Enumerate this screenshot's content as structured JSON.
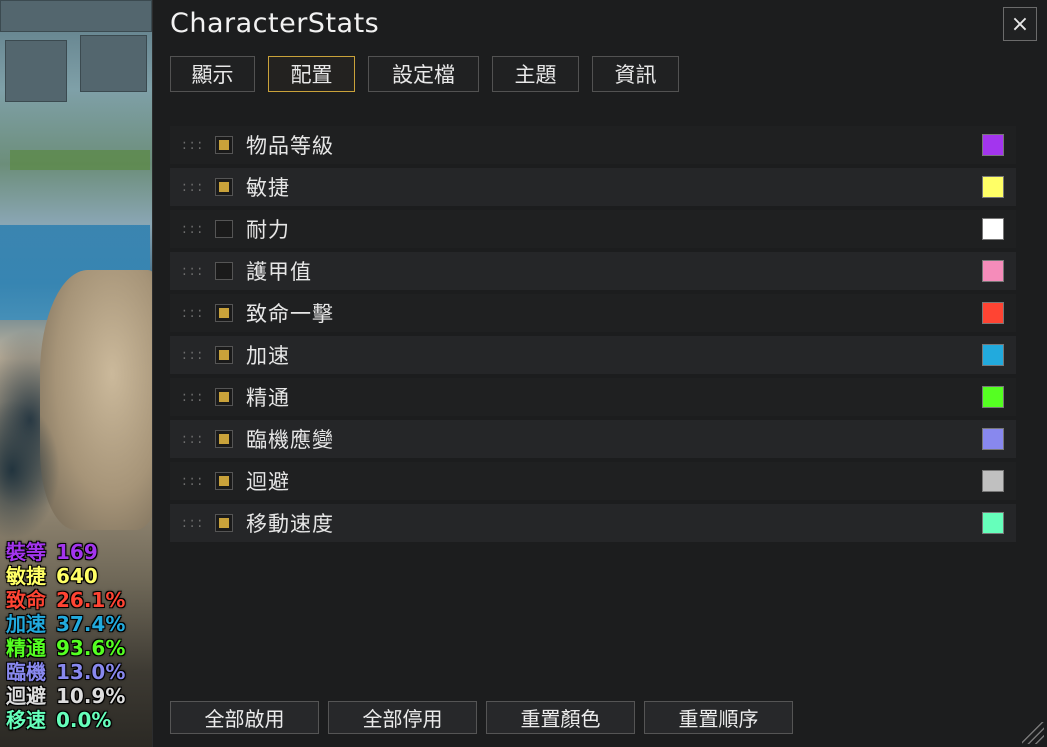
{
  "overlay": {
    "stats": [
      {
        "label": "裝等",
        "value": "169",
        "color": "#a335ee"
      },
      {
        "label": "敏捷",
        "value": "640",
        "color": "#ffff66"
      },
      {
        "label": "致命",
        "value": "26.1%",
        "color": "#ff4433"
      },
      {
        "label": "加速",
        "value": "37.4%",
        "color": "#22aadd"
      },
      {
        "label": "精通",
        "value": "93.6%",
        "color": "#55ff22"
      },
      {
        "label": "臨機",
        "value": "13.0%",
        "color": "#8888ee"
      },
      {
        "label": "迴避",
        "value": "10.9%",
        "color": "#dddddd"
      },
      {
        "label": "移速",
        "value": "0.0%",
        "color": "#66ffbb"
      }
    ]
  },
  "window": {
    "title": "CharacterStats",
    "close_label": "×",
    "tabs": [
      {
        "label": "顯示",
        "active": false
      },
      {
        "label": "配置",
        "active": true
      },
      {
        "label": "設定檔",
        "active": false
      },
      {
        "label": "主題",
        "active": false
      },
      {
        "label": "資訊",
        "active": false
      }
    ],
    "drag_handle": ":::",
    "rows": [
      {
        "label": "物品等級",
        "checked": true,
        "color": "#a335ee"
      },
      {
        "label": "敏捷",
        "checked": true,
        "color": "#ffff66"
      },
      {
        "label": "耐力",
        "checked": false,
        "color": "#ffffff"
      },
      {
        "label": "護甲值",
        "checked": false,
        "color": "#f58cba"
      },
      {
        "label": "致命一擊",
        "checked": true,
        "color": "#ff4433"
      },
      {
        "label": "加速",
        "checked": true,
        "color": "#22aadd"
      },
      {
        "label": "精通",
        "checked": true,
        "color": "#55ff22"
      },
      {
        "label": "臨機應變",
        "checked": true,
        "color": "#8888ee"
      },
      {
        "label": "迴避",
        "checked": true,
        "color": "#c0c0c0"
      },
      {
        "label": "移動速度",
        "checked": true,
        "color": "#66ffbb"
      }
    ],
    "buttons": {
      "enable_all": "全部啟用",
      "disable_all": "全部停用",
      "reset_colors": "重置顏色",
      "reset_order": "重置順序"
    }
  }
}
